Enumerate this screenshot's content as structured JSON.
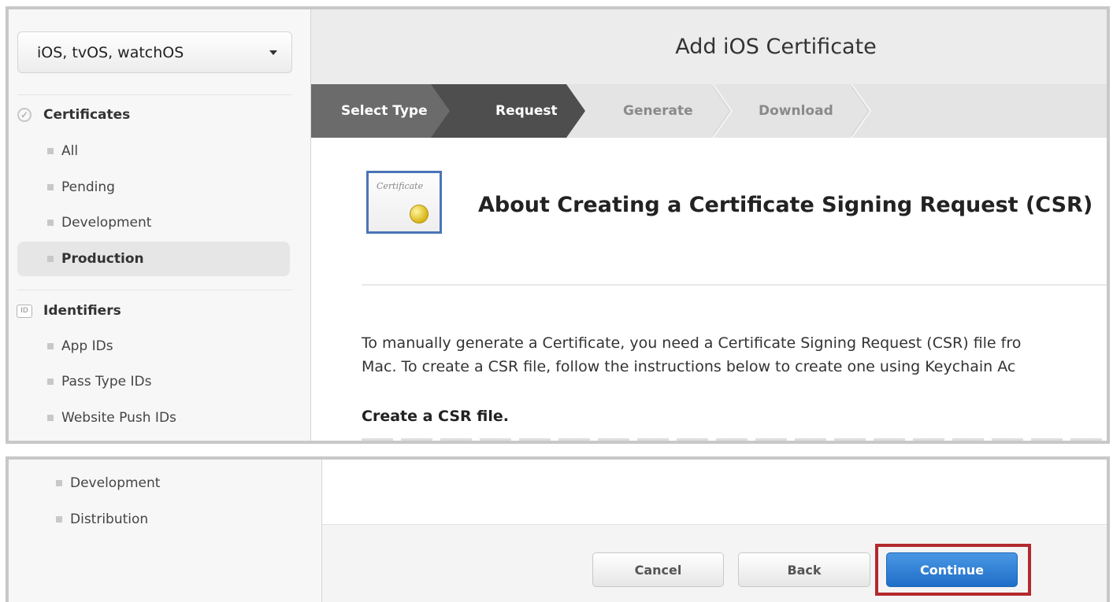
{
  "sidebar": {
    "platform": "iOS, tvOS, watchOS",
    "certificates_heading": "Certificates",
    "certificate_items": [
      "All",
      "Pending",
      "Development",
      "Production"
    ],
    "identifiers_heading": "Identifiers",
    "identifier_items": [
      "App IDs",
      "Pass Type IDs",
      "Website Push IDs"
    ],
    "lower_items": [
      "Development",
      "Distribution"
    ],
    "id_icon_text": "ID"
  },
  "header": {
    "title": "Add iOS Certificate"
  },
  "steps": [
    "Select Type",
    "Request",
    "Generate",
    "Download"
  ],
  "content": {
    "cert_script": "Certificate",
    "about_title": "About Creating a Certificate Signing Request (CSR)",
    "intro_line1": "To manually generate a Certificate, you need a Certificate Signing Request (CSR) file fro",
    "intro_line2": "Mac. To create a CSR file, follow the instructions below to create one using Keychain Ac",
    "csr_heading": "Create a CSR file."
  },
  "footer": {
    "cancel": "Cancel",
    "back": "Back",
    "continue": "Continue"
  },
  "colors": {
    "highlight": "#b3292d",
    "primary_button": "#2b7fd6",
    "active_step": "#4e4e4e"
  }
}
